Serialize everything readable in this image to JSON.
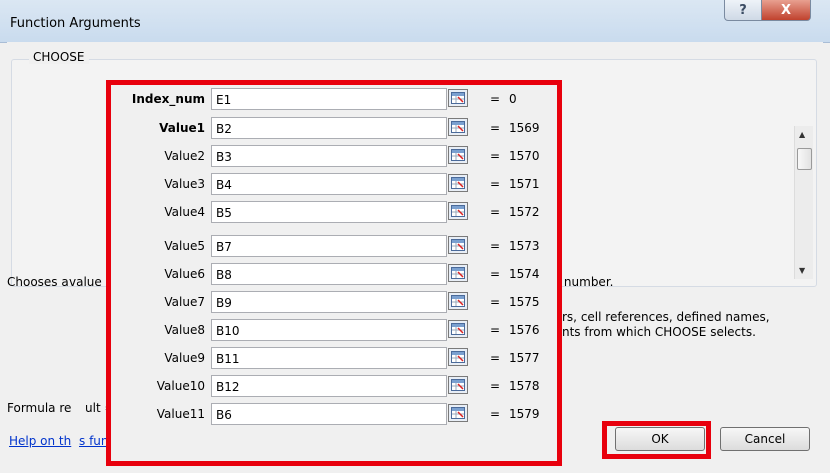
{
  "window": {
    "title": "Function Arguments",
    "help_glyph": "?",
    "close_glyph": "X"
  },
  "group": {
    "title": "CHOOSE"
  },
  "scroll": {
    "up": "▲",
    "down": "▼"
  },
  "description": {
    "line1_left": "Chooses a",
    "line1_mid": "value",
    "line1_right": "x number.",
    "line2_right": "rs, cell references, defined names,",
    "line3_right": "nts from which CHOOSE selects."
  },
  "formula": {
    "label_left": "Formula re",
    "label_right": "ult ="
  },
  "help_link": {
    "part1": "Help on th",
    "part2": "s fun"
  },
  "buttons": {
    "ok": "OK",
    "cancel": "Cancel"
  },
  "arguments": [
    {
      "label": "Index_num",
      "value": "E1",
      "result": "0",
      "bold": true
    },
    {
      "label": "Value1",
      "value": "B2",
      "result": "1569",
      "bold": true
    },
    {
      "label": "Value2",
      "value": "B3",
      "result": "1570",
      "bold": false
    },
    {
      "label": "Value3",
      "value": "B4",
      "result": "1571",
      "bold": false
    },
    {
      "label": "Value4",
      "value": "B5",
      "result": "1572",
      "bold": false
    },
    {
      "label": "Value5",
      "value": "B7",
      "result": "1573",
      "bold": false
    },
    {
      "label": "Value6",
      "value": "B8",
      "result": "1574",
      "bold": false
    },
    {
      "label": "Value7",
      "value": "B9",
      "result": "1575",
      "bold": false
    },
    {
      "label": "Value8",
      "value": "B10",
      "result": "1576",
      "bold": false
    },
    {
      "label": "Value9",
      "value": "B11",
      "result": "1577",
      "bold": false
    },
    {
      "label": "Value10",
      "value": "B12",
      "result": "1578",
      "bold": false
    },
    {
      "label": "Value11",
      "value": "B6",
      "result": "1579",
      "bold": false
    }
  ],
  "equals_sign": "=",
  "colors": {
    "highlight": "#e8000d",
    "link": "#0033cc"
  }
}
